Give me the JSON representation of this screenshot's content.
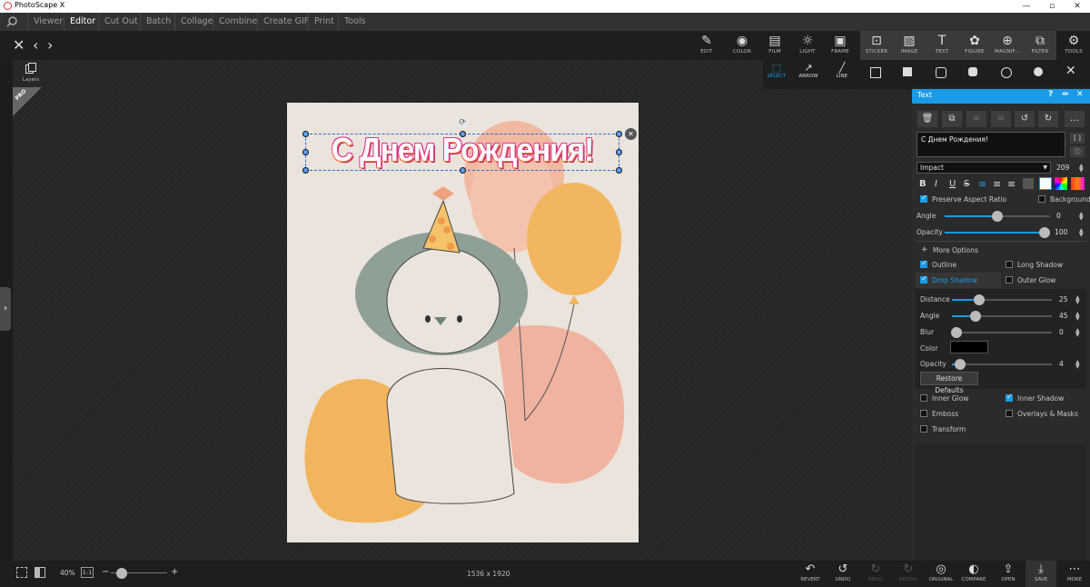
{
  "window": {
    "title": "PhotoScape X"
  },
  "menu": [
    "Viewer",
    "Editor",
    "Cut Out",
    "Batch",
    "Collage",
    "Combine",
    "Create GIF",
    "Print",
    "Tools"
  ],
  "tools": [
    {
      "label": "EDIT",
      "icon": "edit-icon"
    },
    {
      "label": "COLOR",
      "icon": "color-icon"
    },
    {
      "label": "FILM",
      "icon": "film-icon"
    },
    {
      "label": "LIGHT",
      "icon": "light-icon"
    },
    {
      "label": "FRAME",
      "icon": "frame-icon"
    },
    {
      "label": "STICKER",
      "icon": "sticker-icon"
    },
    {
      "label": "IMAGE",
      "icon": "image-icon"
    },
    {
      "label": "TEXT",
      "icon": "text-icon"
    },
    {
      "label": "FIGURE",
      "icon": "figure-icon"
    },
    {
      "label": "MAGNIF...",
      "icon": "magnifier-icon"
    },
    {
      "label": "FILTER",
      "icon": "filter-icon"
    },
    {
      "label": "TOOLS",
      "icon": "tools-icon"
    }
  ],
  "subtools": [
    "SELECT",
    "ARROW",
    "LINE"
  ],
  "layers_label": "Layers",
  "pro_badge": "PRO",
  "canvas_text": "С Днем Рождения!",
  "panel": {
    "title": "Text",
    "text_value": "С Днем Рождения!",
    "font": "Impact",
    "font_size": "209",
    "preserve_aspect": "Preserve Aspect Ratio",
    "background": "Background",
    "angle_label": "Angle",
    "angle_value": "0",
    "opacity_label": "Opacity",
    "opacity_value": "100",
    "more_options": "More Options",
    "outline": "Outline",
    "long_shadow": "Long Shadow",
    "drop_shadow": "Drop Shadow",
    "outer_glow": "Outer Glow",
    "distance_label": "Distance",
    "distance_value": "25",
    "ds_angle_label": "Angle",
    "ds_angle_value": "45",
    "blur_label": "Blur",
    "blur_value": "0",
    "color_label": "Color",
    "ds_opacity_label": "Opacity",
    "ds_opacity_value": "4",
    "restore": "Restore Defaults",
    "inner_glow": "Inner Glow",
    "inner_shadow": "Inner Shadow",
    "emboss": "Emboss",
    "overlays": "Overlays & Masks",
    "transform": "Transform"
  },
  "status": {
    "zoom": "40%",
    "ratio": "1:1",
    "dimensions": "1536 x 1920"
  },
  "bottom_tools": [
    "REVERT",
    "UNDO",
    "REDO",
    "REDO+",
    "ORIGINAL",
    "COMPARE",
    "OPEN",
    "SAVE",
    "MORE"
  ],
  "colors": {
    "accent": "#1a9be6",
    "text_fill": "#ffffff",
    "text_outline": "#e0368c"
  }
}
